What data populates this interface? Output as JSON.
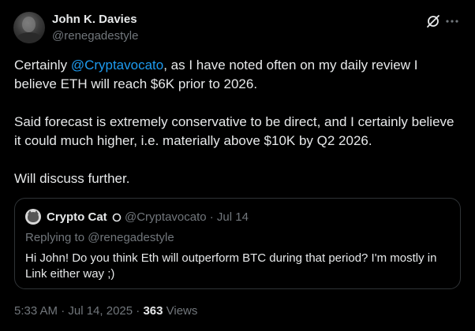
{
  "post": {
    "author": {
      "name": "John K. Davies",
      "handle": "@renegadestyle"
    },
    "icons": {
      "grok": "grok-icon",
      "more": "more-icon"
    },
    "body": {
      "p1_prefix": "Certainly ",
      "p1_mention": "@Cryptavocato",
      "p1_suffix": ", as I have noted often on my daily review I believe ETH will reach $6K prior to 2026.",
      "p2": "Said forecast is extremely conservative to be direct, and I certainly believe it could much higher, i.e. materially above $10K by Q2 2026.",
      "p3": "Will discuss further."
    },
    "quote": {
      "name": "Crypto Cat",
      "handle_date": "@Cryptavocato · Jul 14",
      "replying_to": "Replying to @renegadestyle",
      "text": "Hi John! Do you think Eth will outperform BTC during that period? I'm mostly in Link either way ;)"
    },
    "footer": {
      "timestamp": "5:33 AM · Jul 14, 2025 · ",
      "views_count": "363",
      "views_label": " Views"
    }
  },
  "colors": {
    "background": "#000000",
    "text": "#e7e9ea",
    "muted": "#71767b",
    "accent": "#1d9bf0",
    "border": "#2f3336"
  }
}
